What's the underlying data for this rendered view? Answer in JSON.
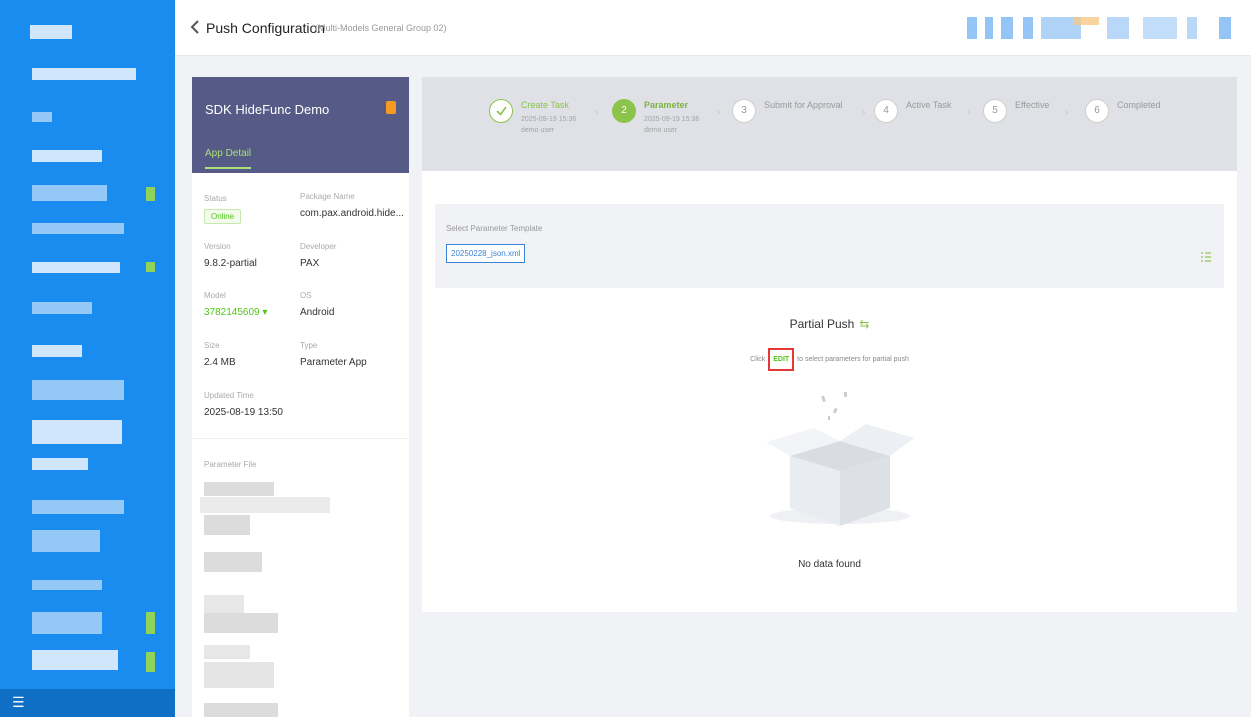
{
  "header": {
    "title": "Push Configuration",
    "subtitle": "(Multi-Models General Group 02)"
  },
  "app": {
    "name": "SDK HideFunc Demo",
    "tab": "App Detail",
    "fields": {
      "status": {
        "label": "Status",
        "value": "Online"
      },
      "package": {
        "label": "Package Name",
        "value": "com.pax.android.hide..."
      },
      "version": {
        "label": "Version",
        "value": "9.8.2-partial"
      },
      "developer": {
        "label": "Developer",
        "value": "PAX"
      },
      "model": {
        "label": "Model",
        "value": "3782145609"
      },
      "os": {
        "label": "OS",
        "value": "Android"
      },
      "size": {
        "label": "Size",
        "value": "2.4 MB"
      },
      "type": {
        "label": "Type",
        "value": "Parameter App"
      },
      "updated": {
        "label": "Updated Time",
        "value": "2025-08-19 13:50"
      }
    },
    "parameter_file_label": "Parameter File"
  },
  "steps": [
    {
      "num": "",
      "title": "Create Task",
      "time": "2025-09-19 15:36",
      "user": "demo user",
      "state": "done"
    },
    {
      "num": "2",
      "title": "Parameter",
      "time": "2025-09-19 15:36",
      "user": "demo user",
      "state": "active"
    },
    {
      "num": "3",
      "title": "Submit for Approval",
      "state": "todo"
    },
    {
      "num": "4",
      "title": "Active Task",
      "state": "todo"
    },
    {
      "num": "5",
      "title": "Effective",
      "state": "todo"
    },
    {
      "num": "6",
      "title": "Completed",
      "state": "todo"
    }
  ],
  "param": {
    "template_label": "Select Parameter Template",
    "template_value": "20250228_json.xml",
    "partial_title": "Partial Push",
    "hint_pre": "Click",
    "hint_edit": "EDIT",
    "hint_post": "to select parameters for partial push",
    "empty_text": "No data found"
  },
  "colors": {
    "nav": "#1a8cf0",
    "accent": "#8cc34b",
    "app_header": "#565a86",
    "highlight": "#e63636"
  }
}
